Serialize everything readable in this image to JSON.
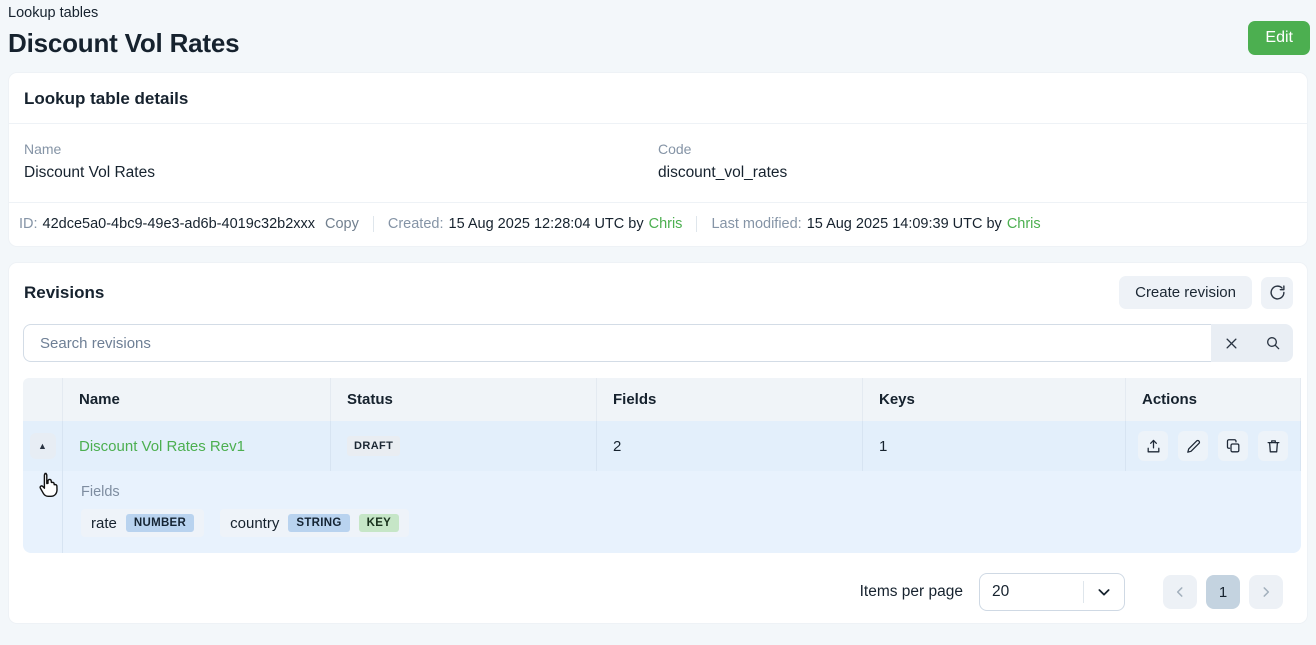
{
  "header": {
    "breadcrumb": "Lookup tables",
    "title": "Discount Vol Rates",
    "edit_button": "Edit"
  },
  "details": {
    "title": "Lookup table details",
    "name_label": "Name",
    "name_value": "Discount Vol Rates",
    "code_label": "Code",
    "code_value": "discount_vol_rates",
    "id_label": "ID:",
    "id_value": "42dce5a0-4bc9-49e3-ad6b-4019c32b2xxx",
    "copy_button": "Copy",
    "created_label": "Created:",
    "created_text": "15 Aug 2025 12:28:04 UTC by",
    "created_user": "Chris",
    "modified_label": "Last modified:",
    "modified_text": "15 Aug 2025 14:09:39 UTC by",
    "modified_user": "Chris"
  },
  "revisions": {
    "title": "Revisions",
    "create_button": "Create revision",
    "search": {
      "placeholder": "Search revisions"
    },
    "table": {
      "headers": [
        "Name",
        "Status",
        "Fields",
        "Keys",
        "Actions"
      ],
      "rows": [
        {
          "name": "Discount Vol Rates Rev1",
          "status": "DRAFT",
          "fields": "2",
          "keys": "1"
        }
      ],
      "expanded": {
        "label": "Fields",
        "items": [
          {
            "name": "rate",
            "badges": [
              "NUMBER"
            ]
          },
          {
            "name": "country",
            "badges": [
              "STRING",
              "KEY"
            ]
          }
        ]
      }
    },
    "pagination": {
      "items_per_page_label": "Items per page",
      "page_size": "20",
      "current_page": "1"
    }
  },
  "icons": {
    "expander_glyph": "▲"
  },
  "colors": {
    "accent_green": "#4caf50",
    "row_highlight": "#e3effb",
    "expanded_row": "#e8f2fd",
    "table_header_bg": "#f0f4f8",
    "badge_type_bg": "#b9d3ef",
    "badge_key_bg": "#c6e6c7"
  }
}
